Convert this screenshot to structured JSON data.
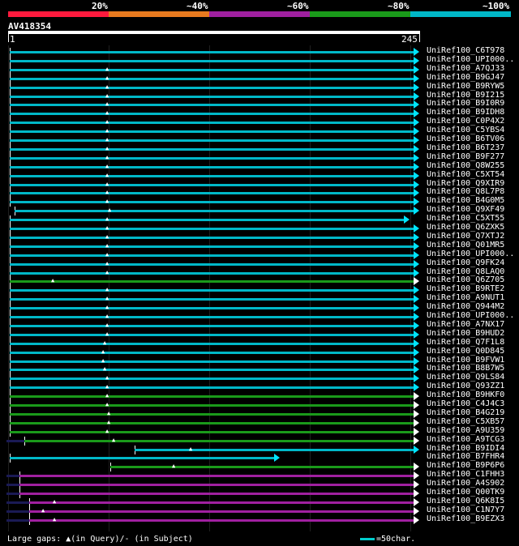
{
  "legend": {
    "labels": [
      "20%",
      "~40%",
      "~60%",
      "~80%",
      "~100%"
    ],
    "colors": [
      "#ff1a3d",
      "#e87a1f",
      "#a020a0",
      "#1a9a1a",
      "#00b8c8"
    ]
  },
  "query": {
    "name": "AV418354",
    "start": "1",
    "end": "245"
  },
  "hits": [
    {
      "name": "UniRef100_C6T978",
      "color": "#00b8c8"
    },
    {
      "name": "UniRef100_UPI000..",
      "color": "#00b8c8"
    },
    {
      "name": "UniRef100_A7QJ33",
      "color": "#00b8c8"
    },
    {
      "name": "UniRef100_B9GJ47",
      "color": "#00b8c8"
    },
    {
      "name": "UniRef100_B9RYW5",
      "color": "#00b8c8"
    },
    {
      "name": "UniRef100_B9I215",
      "color": "#00b8c8"
    },
    {
      "name": "UniRef100_B9I0R9",
      "color": "#00b8c8"
    },
    {
      "name": "UniRef100_B9IDH8",
      "color": "#00b8c8"
    },
    {
      "name": "UniRef100_C0P4X2",
      "color": "#00b8c8"
    },
    {
      "name": "UniRef100_C5YBS4",
      "color": "#00b8c8"
    },
    {
      "name": "UniRef100_B6TV06",
      "color": "#00b8c8"
    },
    {
      "name": "UniRef100_B6T237",
      "color": "#00b8c8"
    },
    {
      "name": "UniRef100_B9F277",
      "color": "#00b8c8"
    },
    {
      "name": "UniRef100_Q8W255",
      "color": "#00b8c8"
    },
    {
      "name": "UniRef100_C5XT54",
      "color": "#00b8c8"
    },
    {
      "name": "UniRef100_Q9XIR9",
      "color": "#00b8c8"
    },
    {
      "name": "UniRef100_Q8L7P8",
      "color": "#00b8c8"
    },
    {
      "name": "UniRef100_B4G0M5",
      "color": "#00b8c8"
    },
    {
      "name": "UniRef100_Q9XF49",
      "color": "#00b8c8"
    },
    {
      "name": "UniRef100_C5XT55",
      "color": "#00b8c8"
    },
    {
      "name": "UniRef100_Q6ZXK5",
      "color": "#00b8c8"
    },
    {
      "name": "UniRef100_Q7XTJ2",
      "color": "#00b8c8"
    },
    {
      "name": "UniRef100_Q01MR5",
      "color": "#00b8c8"
    },
    {
      "name": "UniRef100_UPI000..",
      "color": "#00b8c8"
    },
    {
      "name": "UniRef100_Q9FK24",
      "color": "#00b8c8"
    },
    {
      "name": "UniRef100_Q8LAQ0",
      "color": "#00b8c8"
    },
    {
      "name": "UniRef100_Q6Z705",
      "color": "#1a9a1a"
    },
    {
      "name": "UniRef100_B9RTE2",
      "color": "#00b8c8"
    },
    {
      "name": "UniRef100_A9NUT1",
      "color": "#00b8c8"
    },
    {
      "name": "UniRef100_Q944M2",
      "color": "#00b8c8"
    },
    {
      "name": "UniRef100_UPI000..",
      "color": "#00b8c8"
    },
    {
      "name": "UniRef100_A7NX17",
      "color": "#00b8c8"
    },
    {
      "name": "UniRef100_B9HUD2",
      "color": "#00b8c8"
    },
    {
      "name": "UniRef100_Q7F1L8",
      "color": "#00b8c8"
    },
    {
      "name": "UniRef100_Q0D845",
      "color": "#00b8c8"
    },
    {
      "name": "UniRef100_B9FVW1",
      "color": "#00b8c8"
    },
    {
      "name": "UniRef100_B8B7W5",
      "color": "#00b8c8"
    },
    {
      "name": "UniRef100_Q9LS84",
      "color": "#00b8c8"
    },
    {
      "name": "UniRef100_Q93ZZ1",
      "color": "#00b8c8"
    },
    {
      "name": "UniRef100_B9HKF0",
      "color": "#1a9a1a"
    },
    {
      "name": "UniRef100_C4J4C3",
      "color": "#1a9a1a"
    },
    {
      "name": "UniRef100_B4G219",
      "color": "#1a9a1a"
    },
    {
      "name": "UniRef100_C5XB57",
      "color": "#1a9a1a"
    },
    {
      "name": "UniRef100_A9U359",
      "color": "#1a9a1a"
    },
    {
      "name": "UniRef100_A9TCG3",
      "color": "#1a9a1a"
    },
    {
      "name": "UniRef100_B9IDI4",
      "color": "#00b8c8"
    },
    {
      "name": "UniRef100_B7FHR4",
      "color": "#00b8c8"
    },
    {
      "name": "UniRef100_B9P6P6",
      "color": "#1a9a1a"
    },
    {
      "name": "UniRef100_C1FHH3",
      "color": "#a020a0"
    },
    {
      "name": "UniRef100_A4S902",
      "color": "#a020a0"
    },
    {
      "name": "UniRef100_Q00TK9",
      "color": "#a020a0"
    },
    {
      "name": "UniRef100_Q6K8I5",
      "color": "#a020a0"
    },
    {
      "name": "UniRef100_C1N7Y7",
      "color": "#a020a0"
    },
    {
      "name": "UniRef100_B9EZX3",
      "color": "#a020a0"
    }
  ],
  "footer": {
    "gap_text": "Large gaps: ▲(in Query)/- (in Subject)",
    "scale_text": "=50char."
  }
}
